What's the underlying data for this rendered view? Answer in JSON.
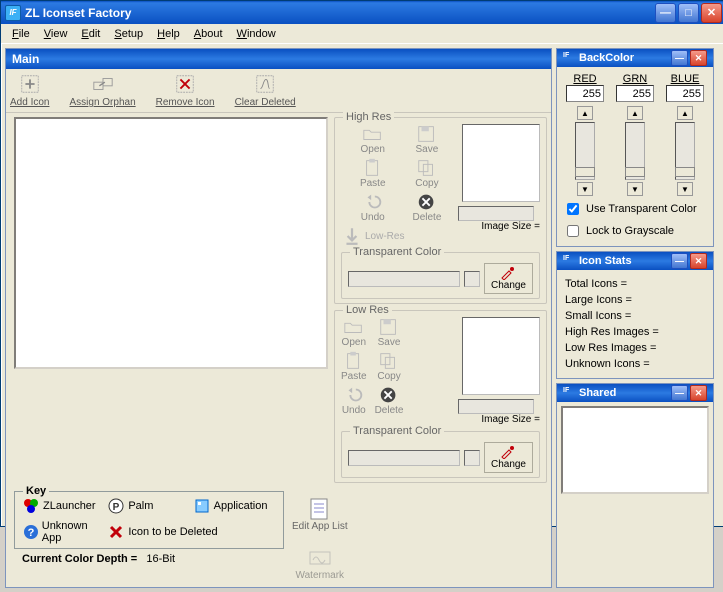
{
  "window": {
    "title": "ZL Iconset Factory"
  },
  "menu": {
    "file": "File",
    "view": "View",
    "edit": "Edit",
    "setup": "Setup",
    "help": "Help",
    "about": "About",
    "window": "Window"
  },
  "main": {
    "title": "Main",
    "toolbar": {
      "add": "Add Icon",
      "assign": "Assign Orphan",
      "remove": "Remove Icon",
      "clear": "Clear Deleted"
    },
    "highres": {
      "legend": "High Res",
      "open": "Open",
      "save": "Save",
      "paste": "Paste",
      "copy": "Copy",
      "undo": "Undo",
      "delete": "Delete",
      "lowres": "Low-Res",
      "imgsize_label": "Image Size ="
    },
    "transparent": {
      "legend": "Transparent Color",
      "change": "Change"
    },
    "lowres": {
      "legend": "Low Res",
      "open": "Open",
      "save": "Save",
      "paste": "Paste",
      "copy": "Copy",
      "undo": "Undo",
      "delete": "Delete",
      "imgsize_label": "Image Size ="
    },
    "key": {
      "legend": "Key",
      "zlauncher": "ZLauncher",
      "palm": "Palm",
      "application": "Application",
      "unknown": "Unknown App",
      "deleted": "Icon to be Deleted"
    },
    "edit_app_list": "Edit App List",
    "watermark": "Watermark",
    "ccd_label": "Current Color Depth =",
    "ccd_value": "16-Bit"
  },
  "backcolor": {
    "title": "BackColor",
    "red_label": "RED",
    "grn_label": "GRN",
    "blue_label": "BLUE",
    "red": "255",
    "grn": "255",
    "blue": "255",
    "use_transparent": "Use Transparent Color",
    "lock_gray": "Lock to Grayscale"
  },
  "iconstats": {
    "title": "Icon Stats",
    "total": "Total Icons =",
    "large": "Large Icons =",
    "small": "Small Icons =",
    "highres": "High Res Images =",
    "lowres": "Low Res Images =",
    "unknown": "Unknown Icons ="
  },
  "shared": {
    "title": "Shared"
  }
}
